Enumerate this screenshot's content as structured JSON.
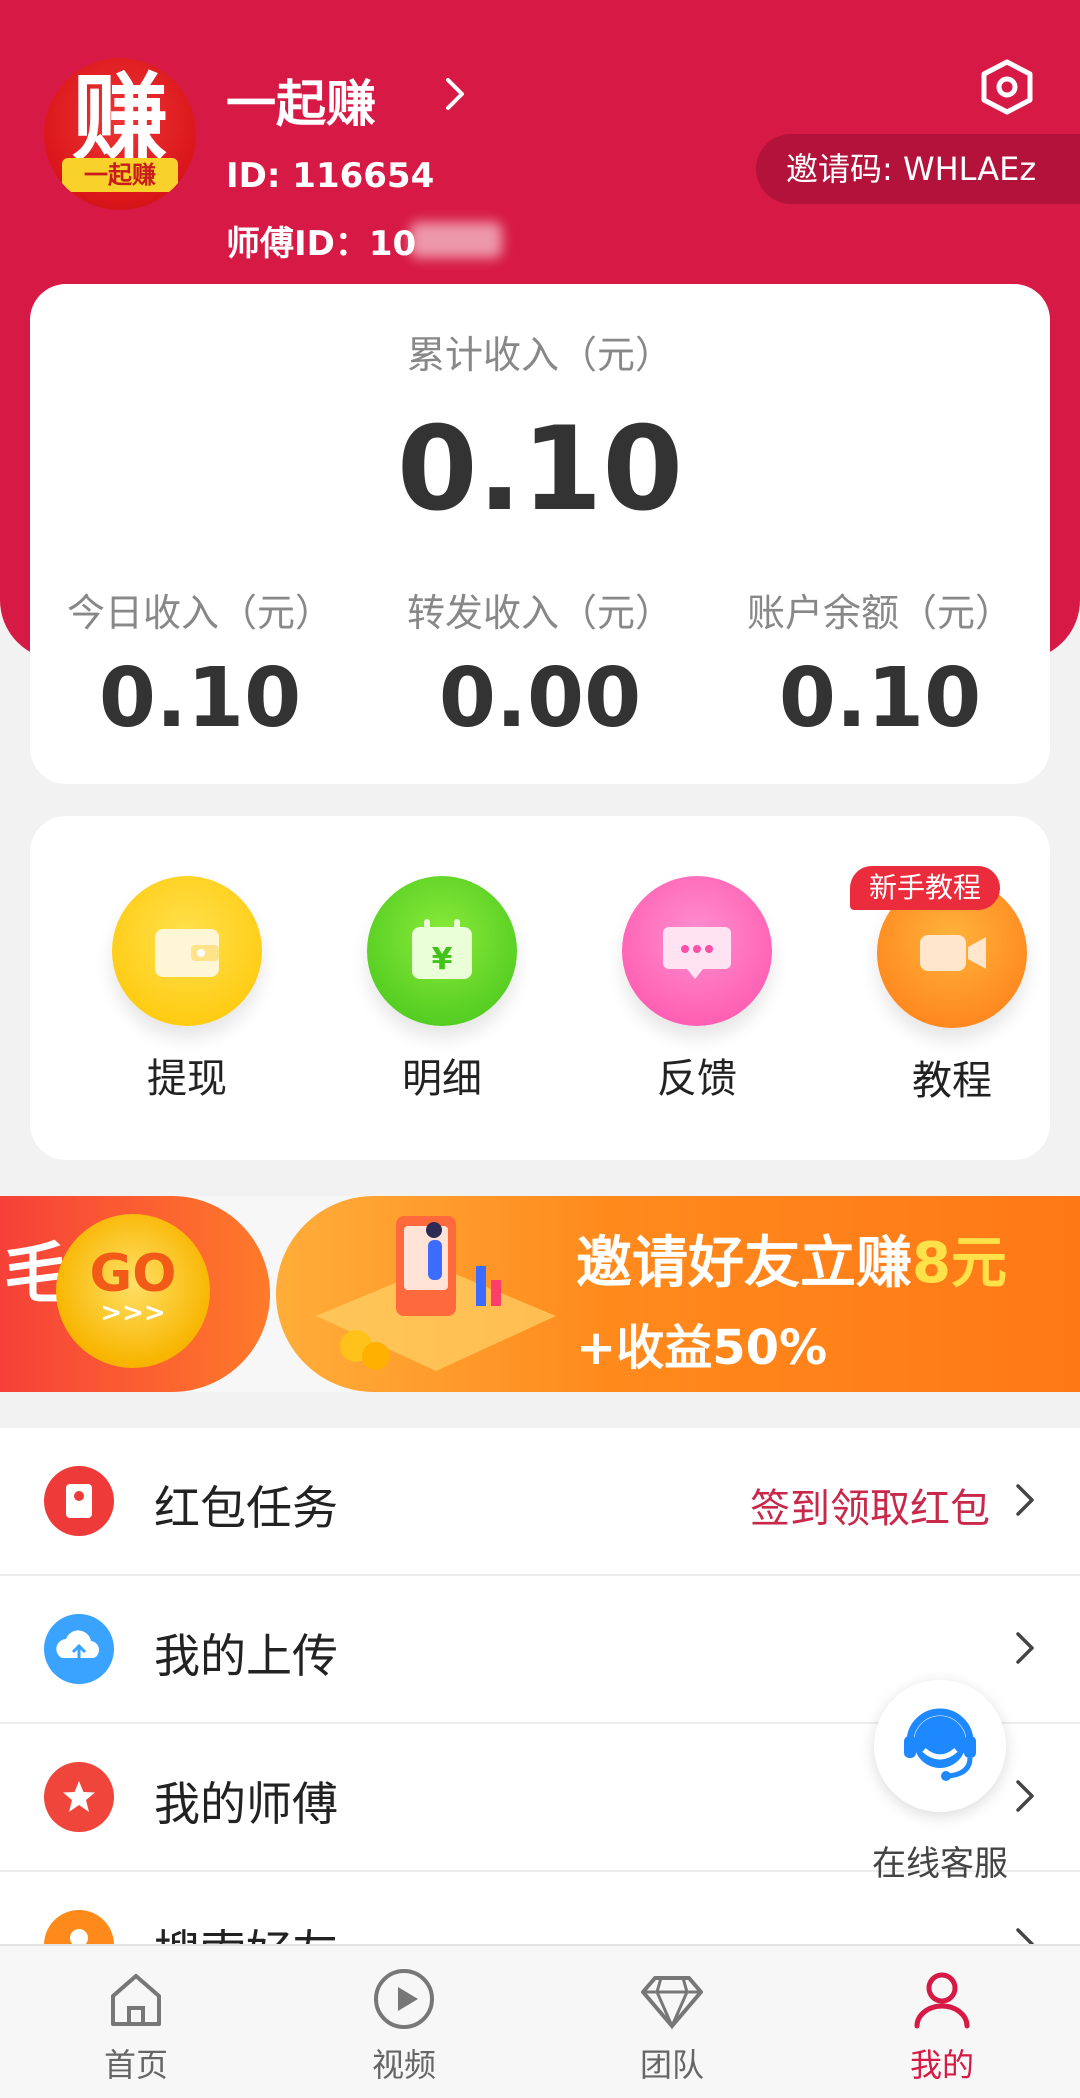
{
  "header": {
    "avatar_char": "赚",
    "avatar_sub": "一起赚",
    "user_name": "一起赚",
    "user_id": "ID: 116654",
    "master_id": "师傅ID：10",
    "invite_code": "邀请码: WHLAEz"
  },
  "earnings": {
    "title": "累计收入（元）",
    "total": "0.10",
    "stats": [
      {
        "label": "今日收入（元）",
        "value": "0.10"
      },
      {
        "label": "转发收入（元）",
        "value": "0.00"
      },
      {
        "label": "账户余额（元）",
        "value": "0.10"
      }
    ]
  },
  "functions": [
    {
      "label": "提现",
      "icon": "wallet-icon",
      "color": "#ffd21f"
    },
    {
      "label": "明细",
      "icon": "calendar-yen-icon",
      "color": "#5fd12a"
    },
    {
      "label": "反馈",
      "icon": "chat-bubble-icon",
      "color": "#ff5fae"
    },
    {
      "label": "教程",
      "icon": "video-camera-icon",
      "color": "#ff8a1c",
      "badge": "新手教程"
    }
  ],
  "banner": {
    "left_text": "毛",
    "go_text": "GO",
    "go_arrows": ">>>",
    "title_a": "邀请好友立赚",
    "title_b": "8元",
    "subtitle": "+收益50%"
  },
  "menu": [
    {
      "label": "红包任务",
      "right": "签到领取红包",
      "icon": "red-envelope-icon",
      "color": "#ef3a3a"
    },
    {
      "label": "我的上传",
      "right": "",
      "icon": "cloud-upload-icon",
      "color": "#3aa2ff"
    },
    {
      "label": "我的师傅",
      "right": "",
      "icon": "star-icon",
      "color": "#f0453a"
    },
    {
      "label": "搜索好友",
      "right": "",
      "icon": "person-icon",
      "color": "#ff8a1c"
    }
  ],
  "support": {
    "label": "在线客服"
  },
  "tabs": [
    {
      "label": "首页",
      "icon": "home-icon"
    },
    {
      "label": "视频",
      "icon": "play-icon"
    },
    {
      "label": "团队",
      "icon": "diamond-icon"
    },
    {
      "label": "我的",
      "icon": "user-icon",
      "active": true
    }
  ],
  "colors": {
    "brand": "#d71a45",
    "accent_text": "#c8284a"
  }
}
